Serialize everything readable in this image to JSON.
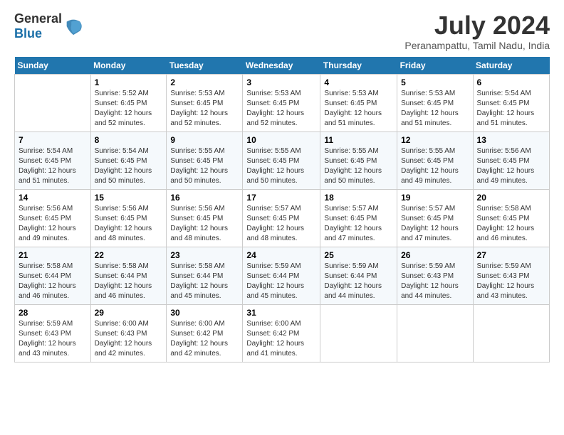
{
  "logo": {
    "general": "General",
    "blue": "Blue"
  },
  "title": "July 2024",
  "location": "Peranampattu, Tamil Nadu, India",
  "days_of_week": [
    "Sunday",
    "Monday",
    "Tuesday",
    "Wednesday",
    "Thursday",
    "Friday",
    "Saturday"
  ],
  "weeks": [
    [
      {
        "num": "",
        "sunrise": "",
        "sunset": "",
        "daylight": ""
      },
      {
        "num": "1",
        "sunrise": "Sunrise: 5:52 AM",
        "sunset": "Sunset: 6:45 PM",
        "daylight": "Daylight: 12 hours and 52 minutes."
      },
      {
        "num": "2",
        "sunrise": "Sunrise: 5:53 AM",
        "sunset": "Sunset: 6:45 PM",
        "daylight": "Daylight: 12 hours and 52 minutes."
      },
      {
        "num": "3",
        "sunrise": "Sunrise: 5:53 AM",
        "sunset": "Sunset: 6:45 PM",
        "daylight": "Daylight: 12 hours and 52 minutes."
      },
      {
        "num": "4",
        "sunrise": "Sunrise: 5:53 AM",
        "sunset": "Sunset: 6:45 PM",
        "daylight": "Daylight: 12 hours and 51 minutes."
      },
      {
        "num": "5",
        "sunrise": "Sunrise: 5:53 AM",
        "sunset": "Sunset: 6:45 PM",
        "daylight": "Daylight: 12 hours and 51 minutes."
      },
      {
        "num": "6",
        "sunrise": "Sunrise: 5:54 AM",
        "sunset": "Sunset: 6:45 PM",
        "daylight": "Daylight: 12 hours and 51 minutes."
      }
    ],
    [
      {
        "num": "7",
        "sunrise": "Sunrise: 5:54 AM",
        "sunset": "Sunset: 6:45 PM",
        "daylight": "Daylight: 12 hours and 51 minutes."
      },
      {
        "num": "8",
        "sunrise": "Sunrise: 5:54 AM",
        "sunset": "Sunset: 6:45 PM",
        "daylight": "Daylight: 12 hours and 50 minutes."
      },
      {
        "num": "9",
        "sunrise": "Sunrise: 5:55 AM",
        "sunset": "Sunset: 6:45 PM",
        "daylight": "Daylight: 12 hours and 50 minutes."
      },
      {
        "num": "10",
        "sunrise": "Sunrise: 5:55 AM",
        "sunset": "Sunset: 6:45 PM",
        "daylight": "Daylight: 12 hours and 50 minutes."
      },
      {
        "num": "11",
        "sunrise": "Sunrise: 5:55 AM",
        "sunset": "Sunset: 6:45 PM",
        "daylight": "Daylight: 12 hours and 50 minutes."
      },
      {
        "num": "12",
        "sunrise": "Sunrise: 5:55 AM",
        "sunset": "Sunset: 6:45 PM",
        "daylight": "Daylight: 12 hours and 49 minutes."
      },
      {
        "num": "13",
        "sunrise": "Sunrise: 5:56 AM",
        "sunset": "Sunset: 6:45 PM",
        "daylight": "Daylight: 12 hours and 49 minutes."
      }
    ],
    [
      {
        "num": "14",
        "sunrise": "Sunrise: 5:56 AM",
        "sunset": "Sunset: 6:45 PM",
        "daylight": "Daylight: 12 hours and 49 minutes."
      },
      {
        "num": "15",
        "sunrise": "Sunrise: 5:56 AM",
        "sunset": "Sunset: 6:45 PM",
        "daylight": "Daylight: 12 hours and 48 minutes."
      },
      {
        "num": "16",
        "sunrise": "Sunrise: 5:56 AM",
        "sunset": "Sunset: 6:45 PM",
        "daylight": "Daylight: 12 hours and 48 minutes."
      },
      {
        "num": "17",
        "sunrise": "Sunrise: 5:57 AM",
        "sunset": "Sunset: 6:45 PM",
        "daylight": "Daylight: 12 hours and 48 minutes."
      },
      {
        "num": "18",
        "sunrise": "Sunrise: 5:57 AM",
        "sunset": "Sunset: 6:45 PM",
        "daylight": "Daylight: 12 hours and 47 minutes."
      },
      {
        "num": "19",
        "sunrise": "Sunrise: 5:57 AM",
        "sunset": "Sunset: 6:45 PM",
        "daylight": "Daylight: 12 hours and 47 minutes."
      },
      {
        "num": "20",
        "sunrise": "Sunrise: 5:58 AM",
        "sunset": "Sunset: 6:45 PM",
        "daylight": "Daylight: 12 hours and 46 minutes."
      }
    ],
    [
      {
        "num": "21",
        "sunrise": "Sunrise: 5:58 AM",
        "sunset": "Sunset: 6:44 PM",
        "daylight": "Daylight: 12 hours and 46 minutes."
      },
      {
        "num": "22",
        "sunrise": "Sunrise: 5:58 AM",
        "sunset": "Sunset: 6:44 PM",
        "daylight": "Daylight: 12 hours and 46 minutes."
      },
      {
        "num": "23",
        "sunrise": "Sunrise: 5:58 AM",
        "sunset": "Sunset: 6:44 PM",
        "daylight": "Daylight: 12 hours and 45 minutes."
      },
      {
        "num": "24",
        "sunrise": "Sunrise: 5:59 AM",
        "sunset": "Sunset: 6:44 PM",
        "daylight": "Daylight: 12 hours and 45 minutes."
      },
      {
        "num": "25",
        "sunrise": "Sunrise: 5:59 AM",
        "sunset": "Sunset: 6:44 PM",
        "daylight": "Daylight: 12 hours and 44 minutes."
      },
      {
        "num": "26",
        "sunrise": "Sunrise: 5:59 AM",
        "sunset": "Sunset: 6:43 PM",
        "daylight": "Daylight: 12 hours and 44 minutes."
      },
      {
        "num": "27",
        "sunrise": "Sunrise: 5:59 AM",
        "sunset": "Sunset: 6:43 PM",
        "daylight": "Daylight: 12 hours and 43 minutes."
      }
    ],
    [
      {
        "num": "28",
        "sunrise": "Sunrise: 5:59 AM",
        "sunset": "Sunset: 6:43 PM",
        "daylight": "Daylight: 12 hours and 43 minutes."
      },
      {
        "num": "29",
        "sunrise": "Sunrise: 6:00 AM",
        "sunset": "Sunset: 6:43 PM",
        "daylight": "Daylight: 12 hours and 42 minutes."
      },
      {
        "num": "30",
        "sunrise": "Sunrise: 6:00 AM",
        "sunset": "Sunset: 6:42 PM",
        "daylight": "Daylight: 12 hours and 42 minutes."
      },
      {
        "num": "31",
        "sunrise": "Sunrise: 6:00 AM",
        "sunset": "Sunset: 6:42 PM",
        "daylight": "Daylight: 12 hours and 41 minutes."
      },
      {
        "num": "",
        "sunrise": "",
        "sunset": "",
        "daylight": ""
      },
      {
        "num": "",
        "sunrise": "",
        "sunset": "",
        "daylight": ""
      },
      {
        "num": "",
        "sunrise": "",
        "sunset": "",
        "daylight": ""
      }
    ]
  ]
}
